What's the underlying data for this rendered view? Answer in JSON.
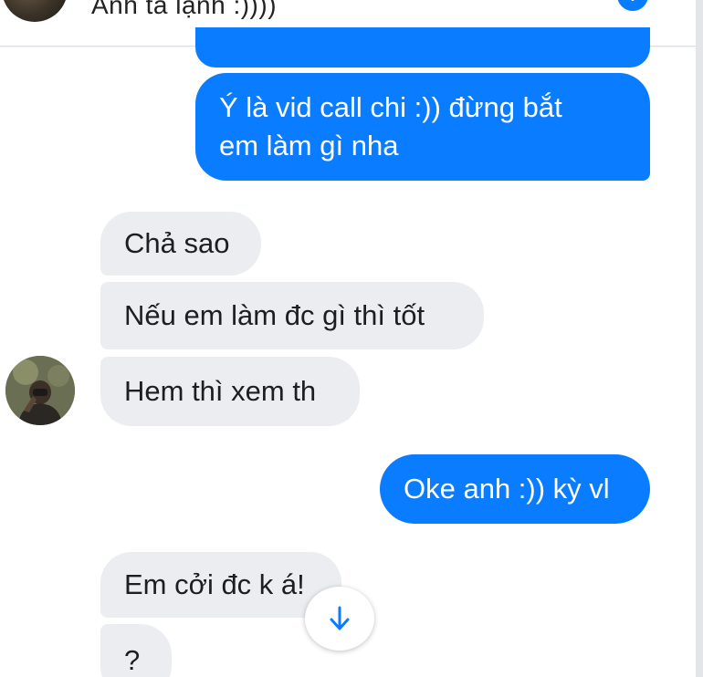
{
  "header": {
    "title": "Anh ta lạnh :))))",
    "info_icon": "info-icon"
  },
  "messages": {
    "outgoing_prev": "",
    "outgoing_1_line1": "Ý là vid call chi :)) đừng bắt",
    "outgoing_1_line2": "em làm gì nha",
    "incoming_1": "Chả sao",
    "incoming_2": "Nếu em làm đc gì thì tốt",
    "incoming_3": "Hem thì xem th",
    "outgoing_2": "Oke anh :)) kỳ vl",
    "incoming_4": "Em cởi đc k á!",
    "incoming_5": "?"
  },
  "colors": {
    "outgoing_bubble": "#0a7cff",
    "incoming_bubble": "#ebedf0",
    "accent": "#0a7cff"
  },
  "icons": {
    "scroll_down": "arrow-down-icon"
  }
}
